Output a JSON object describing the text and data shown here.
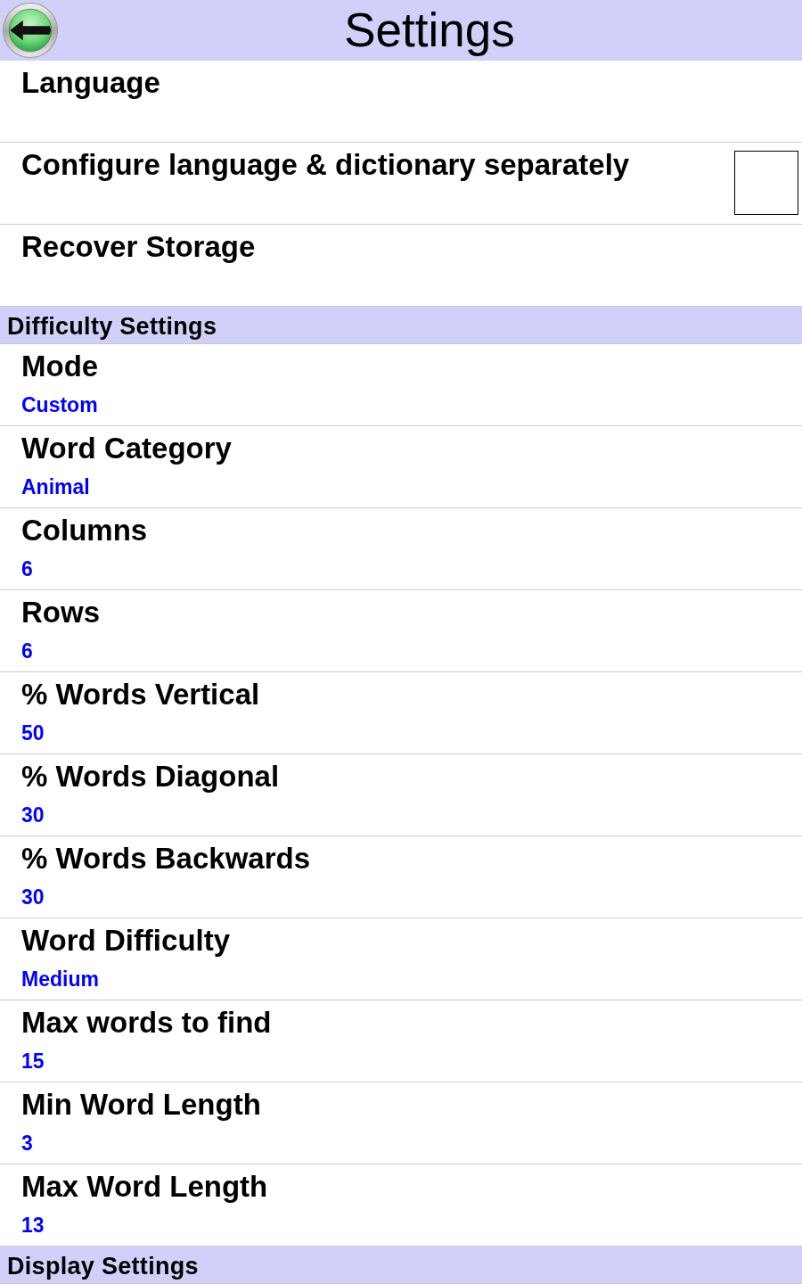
{
  "header": {
    "title": "Settings"
  },
  "sections": [
    {
      "items": [
        {
          "kind": "action",
          "title": "Language"
        },
        {
          "kind": "checkbox",
          "title": "Configure language & dictionary separately",
          "checked": false
        },
        {
          "kind": "action",
          "title": "Recover Storage"
        }
      ]
    },
    {
      "title": "Difficulty Settings",
      "items": [
        {
          "kind": "value",
          "title": "Mode",
          "value": "Custom"
        },
        {
          "kind": "value",
          "title": "Word Category",
          "value": "Animal"
        },
        {
          "kind": "value",
          "title": "Columns",
          "value": "6"
        },
        {
          "kind": "value",
          "title": "Rows",
          "value": "6"
        },
        {
          "kind": "value",
          "title": "% Words Vertical",
          "value": "50"
        },
        {
          "kind": "value",
          "title": "% Words Diagonal",
          "value": "30"
        },
        {
          "kind": "value",
          "title": "% Words Backwards",
          "value": "30"
        },
        {
          "kind": "value",
          "title": "Word Difficulty",
          "value": "Medium"
        },
        {
          "kind": "value",
          "title": "Max words to find",
          "value": "15"
        },
        {
          "kind": "value",
          "title": "Min Word Length",
          "value": "3"
        },
        {
          "kind": "value",
          "title": "Max Word Length",
          "value": "13"
        }
      ]
    },
    {
      "title": "Display Settings"
    }
  ]
}
